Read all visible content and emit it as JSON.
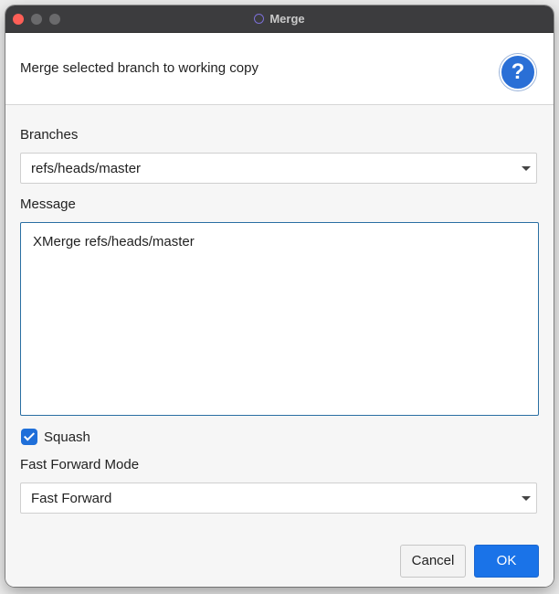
{
  "window": {
    "title": "Merge"
  },
  "header": {
    "text": "Merge selected branch to working copy",
    "help_label": "?"
  },
  "branches": {
    "label": "Branches",
    "selected": "refs/heads/master"
  },
  "message": {
    "label": "Message",
    "value": "XMerge refs/heads/master"
  },
  "squash": {
    "label": "Squash",
    "checked": true
  },
  "fast_forward": {
    "label": "Fast Forward Mode",
    "selected": "Fast Forward"
  },
  "buttons": {
    "cancel": "Cancel",
    "ok": "OK"
  },
  "colors": {
    "accent": "#1a73e8",
    "close": "#ff5f57"
  }
}
